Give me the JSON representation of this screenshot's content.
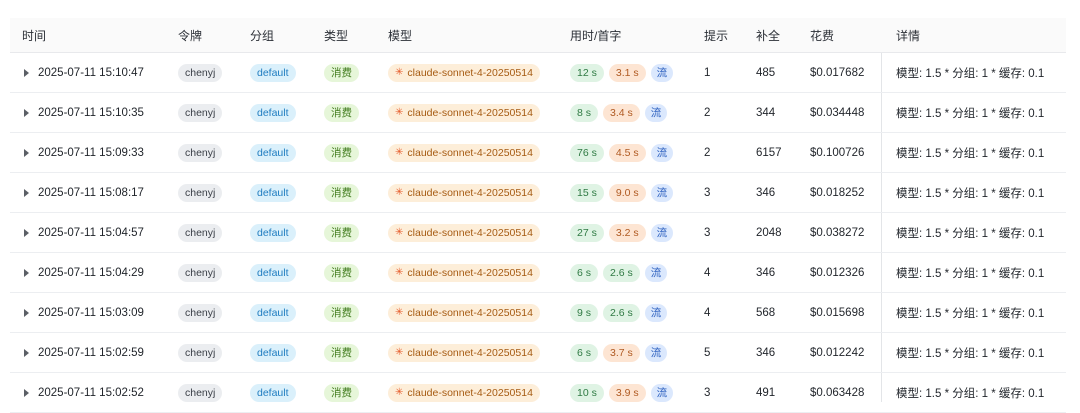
{
  "table": {
    "headers": {
      "time": "时间",
      "token": "令牌",
      "group": "分组",
      "type": "类型",
      "model": "模型",
      "usage": "用时/首字",
      "prompt": "提示",
      "completion": "补全",
      "cost": "花费",
      "detail": "详情"
    },
    "rows": [
      {
        "time": "2025-07-11 15:10:47",
        "token": "chenyj",
        "group": "default",
        "type": "消费",
        "model": "claude-sonnet-4-20250514",
        "use_time": "12 s",
        "first_token": "3.1 s",
        "first_token_color": "orange",
        "stream": "流",
        "prompt": "1",
        "completion": "485",
        "cost": "$0.017682",
        "detail": "模型: 1.5 * 分组: 1 * 缓存: 0.1"
      },
      {
        "time": "2025-07-11 15:10:35",
        "token": "chenyj",
        "group": "default",
        "type": "消费",
        "model": "claude-sonnet-4-20250514",
        "use_time": "8 s",
        "first_token": "3.4 s",
        "first_token_color": "orange",
        "stream": "流",
        "prompt": "2",
        "completion": "344",
        "cost": "$0.034448",
        "detail": "模型: 1.5 * 分组: 1 * 缓存: 0.1"
      },
      {
        "time": "2025-07-11 15:09:33",
        "token": "chenyj",
        "group": "default",
        "type": "消费",
        "model": "claude-sonnet-4-20250514",
        "use_time": "76 s",
        "first_token": "4.5 s",
        "first_token_color": "orange",
        "stream": "流",
        "prompt": "2",
        "completion": "6157",
        "cost": "$0.100726",
        "detail": "模型: 1.5 * 分组: 1 * 缓存: 0.1"
      },
      {
        "time": "2025-07-11 15:08:17",
        "token": "chenyj",
        "group": "default",
        "type": "消费",
        "model": "claude-sonnet-4-20250514",
        "use_time": "15 s",
        "first_token": "9.0 s",
        "first_token_color": "orange",
        "stream": "流",
        "prompt": "3",
        "completion": "346",
        "cost": "$0.018252",
        "detail": "模型: 1.5 * 分组: 1 * 缓存: 0.1"
      },
      {
        "time": "2025-07-11 15:04:57",
        "token": "chenyj",
        "group": "default",
        "type": "消费",
        "model": "claude-sonnet-4-20250514",
        "use_time": "27 s",
        "first_token": "3.2 s",
        "first_token_color": "orange",
        "stream": "流",
        "prompt": "3",
        "completion": "2048",
        "cost": "$0.038272",
        "detail": "模型: 1.5 * 分组: 1 * 缓存: 0.1"
      },
      {
        "time": "2025-07-11 15:04:29",
        "token": "chenyj",
        "group": "default",
        "type": "消费",
        "model": "claude-sonnet-4-20250514",
        "use_time": "6 s",
        "first_token": "2.6 s",
        "first_token_color": "green",
        "stream": "流",
        "prompt": "4",
        "completion": "346",
        "cost": "$0.012326",
        "detail": "模型: 1.5 * 分组: 1 * 缓存: 0.1"
      },
      {
        "time": "2025-07-11 15:03:09",
        "token": "chenyj",
        "group": "default",
        "type": "消费",
        "model": "claude-sonnet-4-20250514",
        "use_time": "9 s",
        "first_token": "2.6 s",
        "first_token_color": "green",
        "stream": "流",
        "prompt": "4",
        "completion": "568",
        "cost": "$0.015698",
        "detail": "模型: 1.5 * 分组: 1 * 缓存: 0.1"
      },
      {
        "time": "2025-07-11 15:02:59",
        "token": "chenyj",
        "group": "default",
        "type": "消费",
        "model": "claude-sonnet-4-20250514",
        "use_time": "6 s",
        "first_token": "3.7 s",
        "first_token_color": "orange",
        "stream": "流",
        "prompt": "5",
        "completion": "346",
        "cost": "$0.012242",
        "detail": "模型: 1.5 * 分组: 1 * 缓存: 0.1"
      },
      {
        "time": "2025-07-11 15:02:52",
        "token": "chenyj",
        "group": "default",
        "type": "消费",
        "model": "claude-sonnet-4-20250514",
        "use_time": "10 s",
        "first_token": "3.9 s",
        "first_token_color": "orange",
        "stream": "流",
        "prompt": "3",
        "completion": "491",
        "cost": "$0.063428",
        "detail": "模型: 1.5 * 分组: 1 * 缓存: 0.1"
      }
    ]
  },
  "icons": {
    "expand": "caret-right-icon",
    "model": "claude-star-icon"
  },
  "colors": {
    "token_tag_bg": "#ebedf0",
    "group_tag_bg": "#daf0fb",
    "type_tag_bg": "#e6f6d9",
    "model_tag_bg": "#fdeed9",
    "time_tag_bg": "#dff3e4",
    "first_token_orange_bg": "#fde5d3",
    "stream_tag_bg": "#dbe8fd",
    "star_color": "#e65a2a"
  }
}
